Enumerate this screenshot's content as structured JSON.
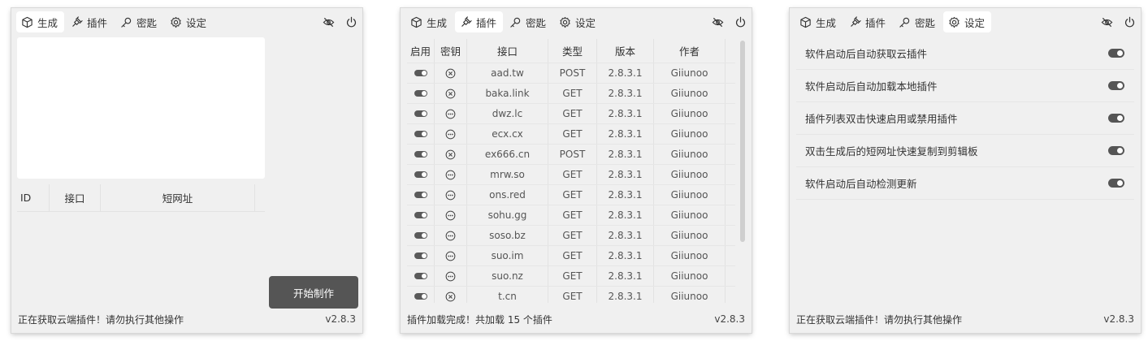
{
  "tabs": {
    "generate": "生成",
    "plugins": "插件",
    "keys": "密匙",
    "settings": "设定"
  },
  "window1": {
    "table_headers": [
      "ID",
      "接口",
      "短网址"
    ],
    "start_button": "开始制作",
    "status": "正在获取云端插件！请勿执行其他操作",
    "version": "v2.8.3"
  },
  "window2": {
    "headers": [
      "启用",
      "密钥",
      "接口",
      "类型",
      "版本",
      "作者"
    ],
    "rows": [
      {
        "enabled": true,
        "key": "x",
        "api": "aad.tw",
        "type": "POST",
        "version": "2.8.3.1",
        "author": "Giiunoo"
      },
      {
        "enabled": true,
        "key": "x",
        "api": "baka.link",
        "type": "GET",
        "version": "2.8.3.1",
        "author": "Giiunoo"
      },
      {
        "enabled": true,
        "key": "dots",
        "api": "dwz.lc",
        "type": "GET",
        "version": "2.8.3.1",
        "author": "Giiunoo"
      },
      {
        "enabled": true,
        "key": "dots",
        "api": "ecx.cx",
        "type": "GET",
        "version": "2.8.3.1",
        "author": "Giiunoo"
      },
      {
        "enabled": true,
        "key": "x",
        "api": "ex666.cn",
        "type": "POST",
        "version": "2.8.3.1",
        "author": "Giiunoo"
      },
      {
        "enabled": true,
        "key": "dots",
        "api": "mrw.so",
        "type": "GET",
        "version": "2.8.3.1",
        "author": "Giiunoo"
      },
      {
        "enabled": true,
        "key": "dots",
        "api": "ons.red",
        "type": "GET",
        "version": "2.8.3.1",
        "author": "Giiunoo"
      },
      {
        "enabled": true,
        "key": "dots",
        "api": "sohu.gg",
        "type": "GET",
        "version": "2.8.3.1",
        "author": "Giiunoo"
      },
      {
        "enabled": true,
        "key": "dots",
        "api": "soso.bz",
        "type": "GET",
        "version": "2.8.3.1",
        "author": "Giiunoo"
      },
      {
        "enabled": true,
        "key": "dots",
        "api": "suo.im",
        "type": "GET",
        "version": "2.8.3.1",
        "author": "Giiunoo"
      },
      {
        "enabled": true,
        "key": "dots",
        "api": "suo.nz",
        "type": "GET",
        "version": "2.8.3.1",
        "author": "Giiunoo"
      },
      {
        "enabled": true,
        "key": "x",
        "api": "t.cn",
        "type": "GET",
        "version": "2.8.3.1",
        "author": "Giiunoo"
      }
    ],
    "status": "插件加载完成！共加载 15 个插件",
    "version": "v2.8.3"
  },
  "window3": {
    "settings": [
      {
        "label": "软件启动后自动获取云插件",
        "on": true
      },
      {
        "label": "软件启动后自动加载本地插件",
        "on": true
      },
      {
        "label": "插件列表双击快速启用或禁用插件",
        "on": true
      },
      {
        "label": "双击生成后的短网址快速复制到剪辑板",
        "on": true
      },
      {
        "label": "软件启动后自动检测更新",
        "on": true
      }
    ],
    "status": "正在获取云端插件！请勿执行其他操作",
    "version": "v2.8.3"
  }
}
